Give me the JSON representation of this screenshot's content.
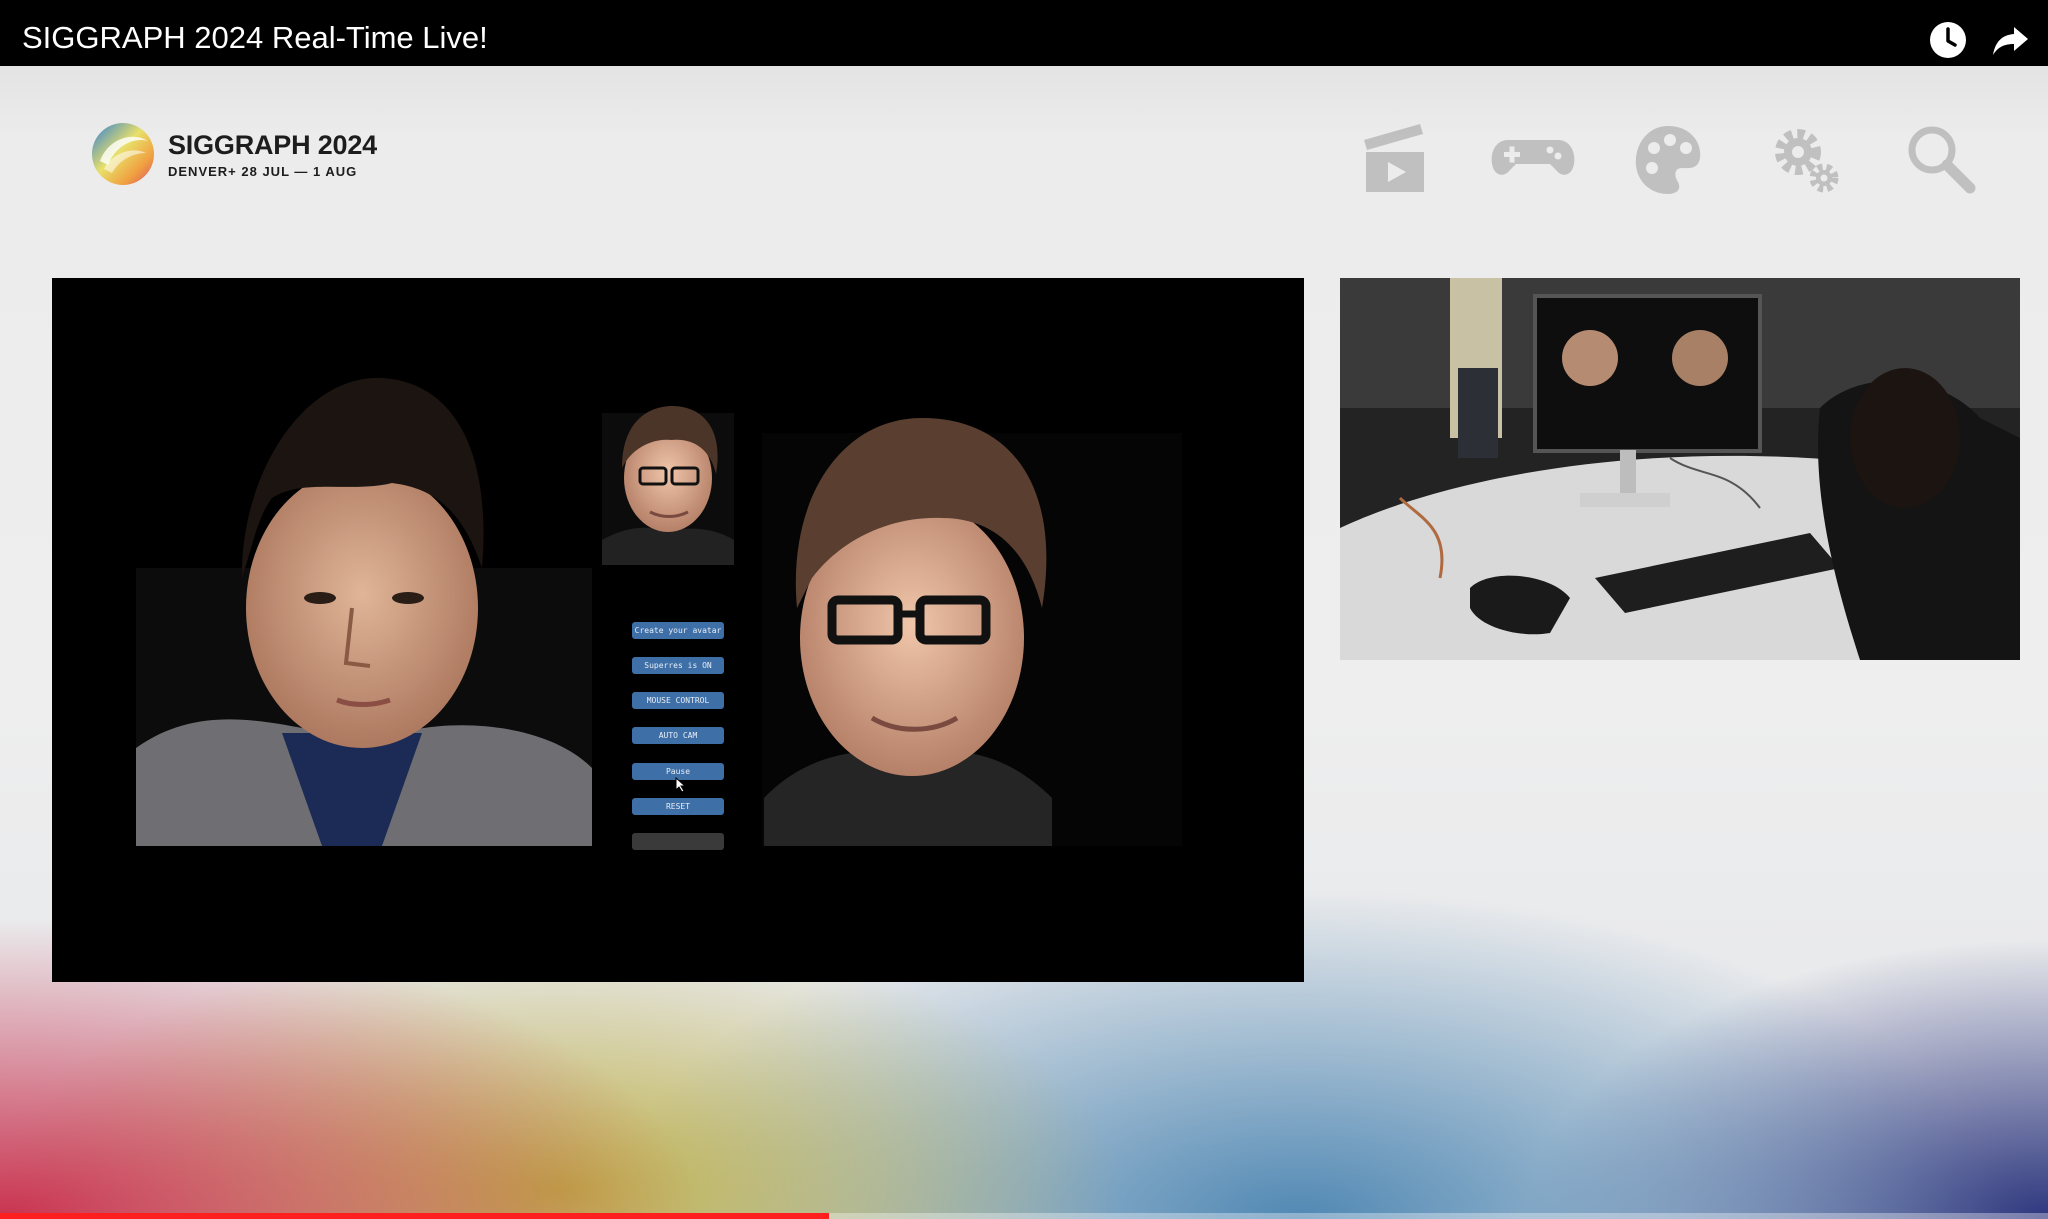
{
  "video": {
    "title": "SIGGRAPH 2024 Real-Time Live!",
    "progress": 0.405
  },
  "top_actions": [
    {
      "name": "watch-later",
      "icon": "clock-icon"
    },
    {
      "name": "share",
      "icon": "share-arrow-icon"
    }
  ],
  "logo": {
    "title": "SIGGRAPH 2024",
    "subtitle": "DENVER+ 28 JUL — 1 AUG"
  },
  "nav_icons": [
    "clapperboard-play-icon",
    "gamepad-icon",
    "palette-icon",
    "gears-icon",
    "magnifier-icon"
  ],
  "demo_ui": {
    "buttons": [
      "Create your avatar",
      "Superres is ON",
      "MOUSE CONTROL",
      "AUTO CAM",
      "Pause",
      "RESET",
      ""
    ]
  },
  "colors": {
    "topbar": "#000000",
    "progress": "#ff1f1f",
    "demo_button": "#3e6fa6"
  }
}
